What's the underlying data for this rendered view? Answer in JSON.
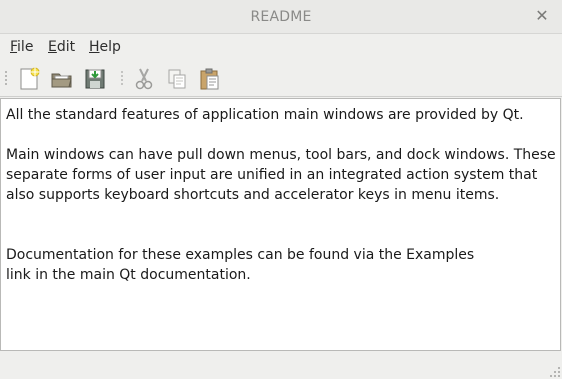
{
  "window": {
    "title": "README"
  },
  "menu": {
    "items": [
      {
        "label": "File",
        "mnemonic": "F",
        "rest": "ile"
      },
      {
        "label": "Edit",
        "mnemonic": "E",
        "rest": "dit"
      },
      {
        "label": "Help",
        "mnemonic": "H",
        "rest": "elp"
      }
    ]
  },
  "toolbar": {
    "buttons": [
      {
        "icon": "new-file-icon"
      },
      {
        "icon": "open-folder-icon"
      },
      {
        "icon": "save-icon"
      },
      {
        "icon": "cut-icon"
      },
      {
        "icon": "copy-icon"
      },
      {
        "icon": "paste-icon"
      }
    ]
  },
  "editor": {
    "content": "All the standard features of application main windows are provided by Qt.\n\nMain windows can have pull down menus, tool bars, and dock windows. These\nseparate forms of user input are unified in an integrated action system that\nalso supports keyboard shortcuts and accelerator keys in menu items.\n\n\nDocumentation for these examples can be found via the Examples\nlink in the main Qt documentation."
  },
  "colors": {
    "window_bg": "#efefed",
    "editor_bg": "#ffffff",
    "title_text": "#8a8a88"
  }
}
